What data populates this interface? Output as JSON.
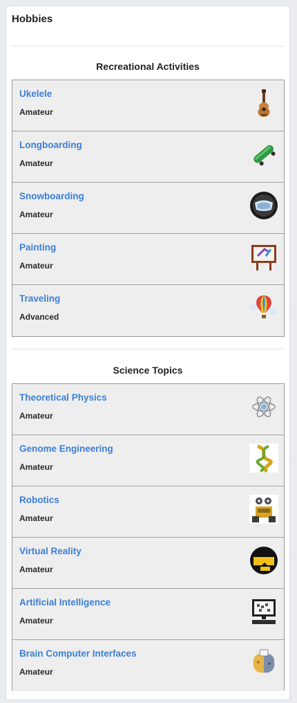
{
  "panel": {
    "title": "Hobbies"
  },
  "sections": [
    {
      "title": "Recreational Activities",
      "items": [
        {
          "name": "Ukelele",
          "level": "Amateur",
          "icon": "ukulele-icon"
        },
        {
          "name": "Longboarding",
          "level": "Amateur",
          "icon": "skateboard-icon"
        },
        {
          "name": "Snowboarding",
          "level": "Amateur",
          "icon": "snow-goggles-icon"
        },
        {
          "name": "Painting",
          "level": "Amateur",
          "icon": "easel-icon"
        },
        {
          "name": "Traveling",
          "level": "Advanced",
          "icon": "hot-air-balloon-icon"
        }
      ]
    },
    {
      "title": "Science Topics",
      "items": [
        {
          "name": "Theoretical Physics",
          "level": "Amateur",
          "icon": "atom-icon"
        },
        {
          "name": "Genome Engineering",
          "level": "Amateur",
          "icon": "dna-icon"
        },
        {
          "name": "Robotics",
          "level": "Amateur",
          "icon": "robot-icon"
        },
        {
          "name": "Virtual Reality",
          "level": "Amateur",
          "icon": "vr-headset-icon"
        },
        {
          "name": "Artificial Intelligence",
          "level": "Amateur",
          "icon": "computer-icon"
        },
        {
          "name": "Brain Computer Interfaces",
          "level": "Amateur",
          "icon": "brain-icon"
        }
      ]
    }
  ]
}
